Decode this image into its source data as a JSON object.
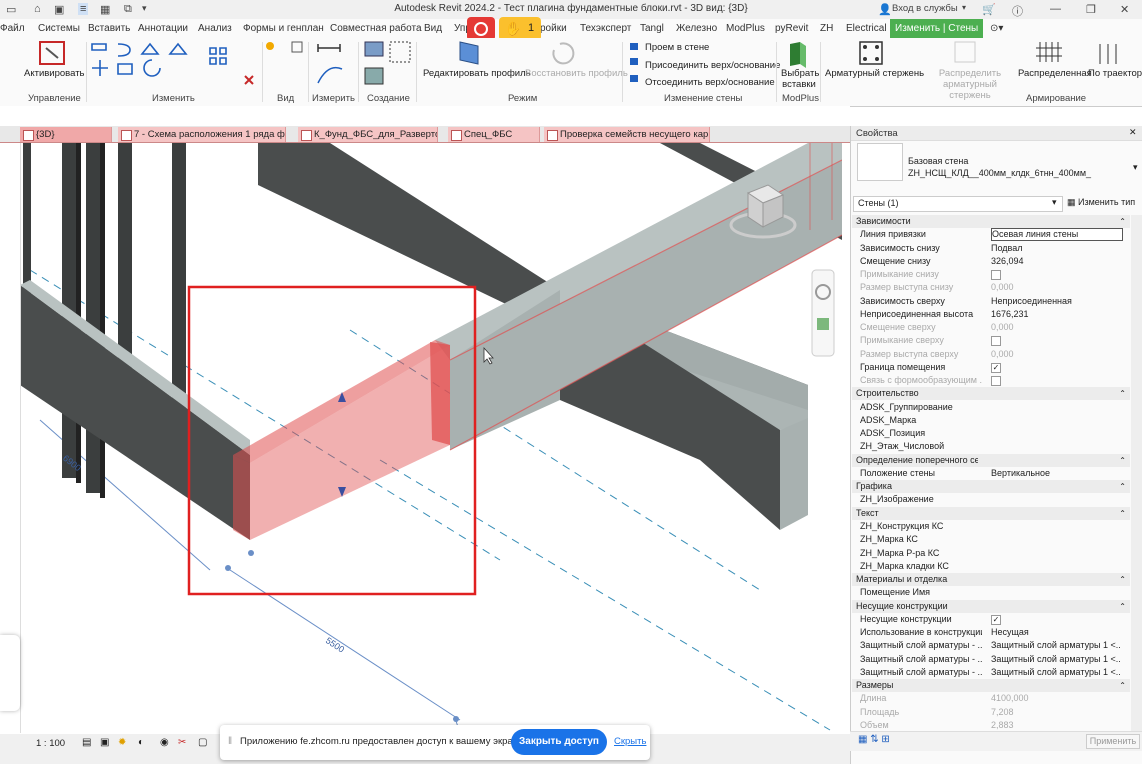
{
  "window": {
    "title": "Autodesk Revit 2024.2 - Тест плагина фундаментные блоки.rvt - 3D вид: {3D}",
    "signin": "Вход в службы",
    "badge_count": "1"
  },
  "menu": {
    "items": [
      "Файл",
      "Системы",
      "Вставить",
      "Аннотации",
      "Анализ",
      "Формы и генплан",
      "Совместная работа",
      "Вид",
      "Упр",
      "ройки",
      "Техэксперт",
      "Tangl",
      "Железно",
      "ModPlus",
      "pyRevit",
      "ZH",
      "Electrical",
      "Изменить | Стены"
    ]
  },
  "ribbon": {
    "activate": "Активировать",
    "edit_profile": "Редактировать профиль",
    "restore_profile": "Восстановить профиль",
    "opening": "Проем в стене",
    "attach": "Присоединить верх/основание",
    "detach": "Отсоединить верх/основание",
    "select_inserts": "Выбрать вставки",
    "rebar_rods": "Арматурный стержень",
    "distribute_rebar": "Распределить арматурный стержень",
    "distributed": "Распределенная",
    "by_path": "По траектори",
    "panels": {
      "control": "Управление",
      "modify": "Изменить",
      "view": "Вид",
      "measure": "Измерить",
      "create": "Создание",
      "mode": "Режим",
      "wall_modify": "Изменение стены",
      "modplus": "ModPlus",
      "reinforcement": "Армирование"
    }
  },
  "tabs": [
    {
      "label": "{3D}"
    },
    {
      "label": "7 - Схема расположения 1 ряда ф..."
    },
    {
      "label": "К_Фунд_ФБС_для_Разверток"
    },
    {
      "label": "Спец_ФБС"
    },
    {
      "label": "Проверка семейств несущего кар..."
    }
  ],
  "viewport": {
    "dim_left": "6900",
    "dim_bottom": "5500"
  },
  "status": {
    "scale": "1 : 100"
  },
  "notification": {
    "text": "Приложению fe.zhcom.ru предоставлен доступ к вашему экрану.",
    "stop_button": "Закрыть доступ",
    "hide_link": "Скрыть"
  },
  "properties": {
    "header": "Свойства",
    "type_family": "Базовая стена",
    "type_name": "ZH_НСЩ_КЛД__400мм_клдк_6тнн_400мм_",
    "selector": "Стены (1)",
    "edit_type": "Изменить тип",
    "apply": "Применить",
    "rows": [
      {
        "name": "Зависимости",
        "section": true
      },
      {
        "name": "Линия привязки",
        "value": "Осевая линия стены",
        "input": true
      },
      {
        "name": "Зависимость снизу",
        "value": "Подвал"
      },
      {
        "name": "Смещение снизу",
        "value": "326,094"
      },
      {
        "name": "Примыкание снизу",
        "value": "",
        "check": false,
        "gray": true
      },
      {
        "name": "Размер выступа снизу",
        "value": "0,000",
        "gray": true
      },
      {
        "name": "Зависимость сверху",
        "value": "Неприсоединенная"
      },
      {
        "name": "Неприсоединенная высота",
        "value": "1676,231"
      },
      {
        "name": "Смещение сверху",
        "value": "0,000",
        "gray": true
      },
      {
        "name": "Примыкание сверху",
        "value": "",
        "check": false,
        "gray": true
      },
      {
        "name": "Размер выступа сверху",
        "value": "0,000",
        "gray": true
      },
      {
        "name": "Граница помещения",
        "value": "",
        "check": true
      },
      {
        "name": "Связь с формообразующим ...",
        "value": "",
        "check": false,
        "gray": true
      },
      {
        "name": "Строительство",
        "section": true
      },
      {
        "name": "ADSK_Группирование",
        "value": ""
      },
      {
        "name": "ADSK_Марка",
        "value": ""
      },
      {
        "name": "ADSK_Позиция",
        "value": ""
      },
      {
        "name": "ZH_Этаж_Числовой",
        "value": ""
      },
      {
        "name": "Определение поперечного сечения",
        "section": true
      },
      {
        "name": "Положение стены",
        "value": "Вертикальное"
      },
      {
        "name": "Графика",
        "section": true
      },
      {
        "name": "ZH_Изображение",
        "value": ""
      },
      {
        "name": "Текст",
        "section": true
      },
      {
        "name": "ZH_Конструкция КС",
        "value": ""
      },
      {
        "name": "ZH_Марка КС",
        "value": ""
      },
      {
        "name": "ZH_Марка Р-ра КС",
        "value": ""
      },
      {
        "name": "ZH_Марка кладки КС",
        "value": ""
      },
      {
        "name": "Материалы и отделка",
        "section": true
      },
      {
        "name": "Помещение Имя",
        "value": ""
      },
      {
        "name": "Несущие конструкции",
        "section": true
      },
      {
        "name": "Несущие конструкции",
        "value": "",
        "check": true
      },
      {
        "name": "Использование в конструкции",
        "value": "Несущая"
      },
      {
        "name": "Защитный слой арматуры - ...",
        "value": "Защитный слой арматуры 1 <..."
      },
      {
        "name": "Защитный слой арматуры - ...",
        "value": "Защитный слой арматуры 1 <..."
      },
      {
        "name": "Защитный слой арматуры - ...",
        "value": "Защитный слой арматуры 1 <..."
      },
      {
        "name": "Размеры",
        "section": true
      },
      {
        "name": "Длина",
        "value": "4100,000",
        "gray": true
      },
      {
        "name": "Площадь",
        "value": "7,208",
        "gray": true
      },
      {
        "name": "Объем",
        "value": "2,883",
        "gray": true
      }
    ]
  },
  "colors": {
    "active_tab": "#4caf50",
    "selection": "#e05050",
    "wall_dark": "#4a4d4d",
    "wall_light": "#a8b1b0",
    "notify_button": "#1a73e8"
  }
}
